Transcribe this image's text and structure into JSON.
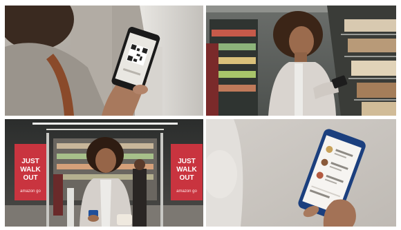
{
  "panels": [
    {
      "id": "panel-gate-qr-scan"
    },
    {
      "id": "panel-shopping-aisle"
    },
    {
      "id": "panel-walk-out-exit"
    },
    {
      "id": "panel-phone-receipt"
    }
  ],
  "exit_sign": {
    "line1": "JUST",
    "line2": "WALK",
    "line3": "OUT",
    "brand": "amazon go"
  },
  "colors": {
    "sign_red": "#c9343f",
    "phone_blue": "#1f4f9a",
    "wall_gray": "#c9c4bd",
    "jacket": "#d9d4cf"
  }
}
